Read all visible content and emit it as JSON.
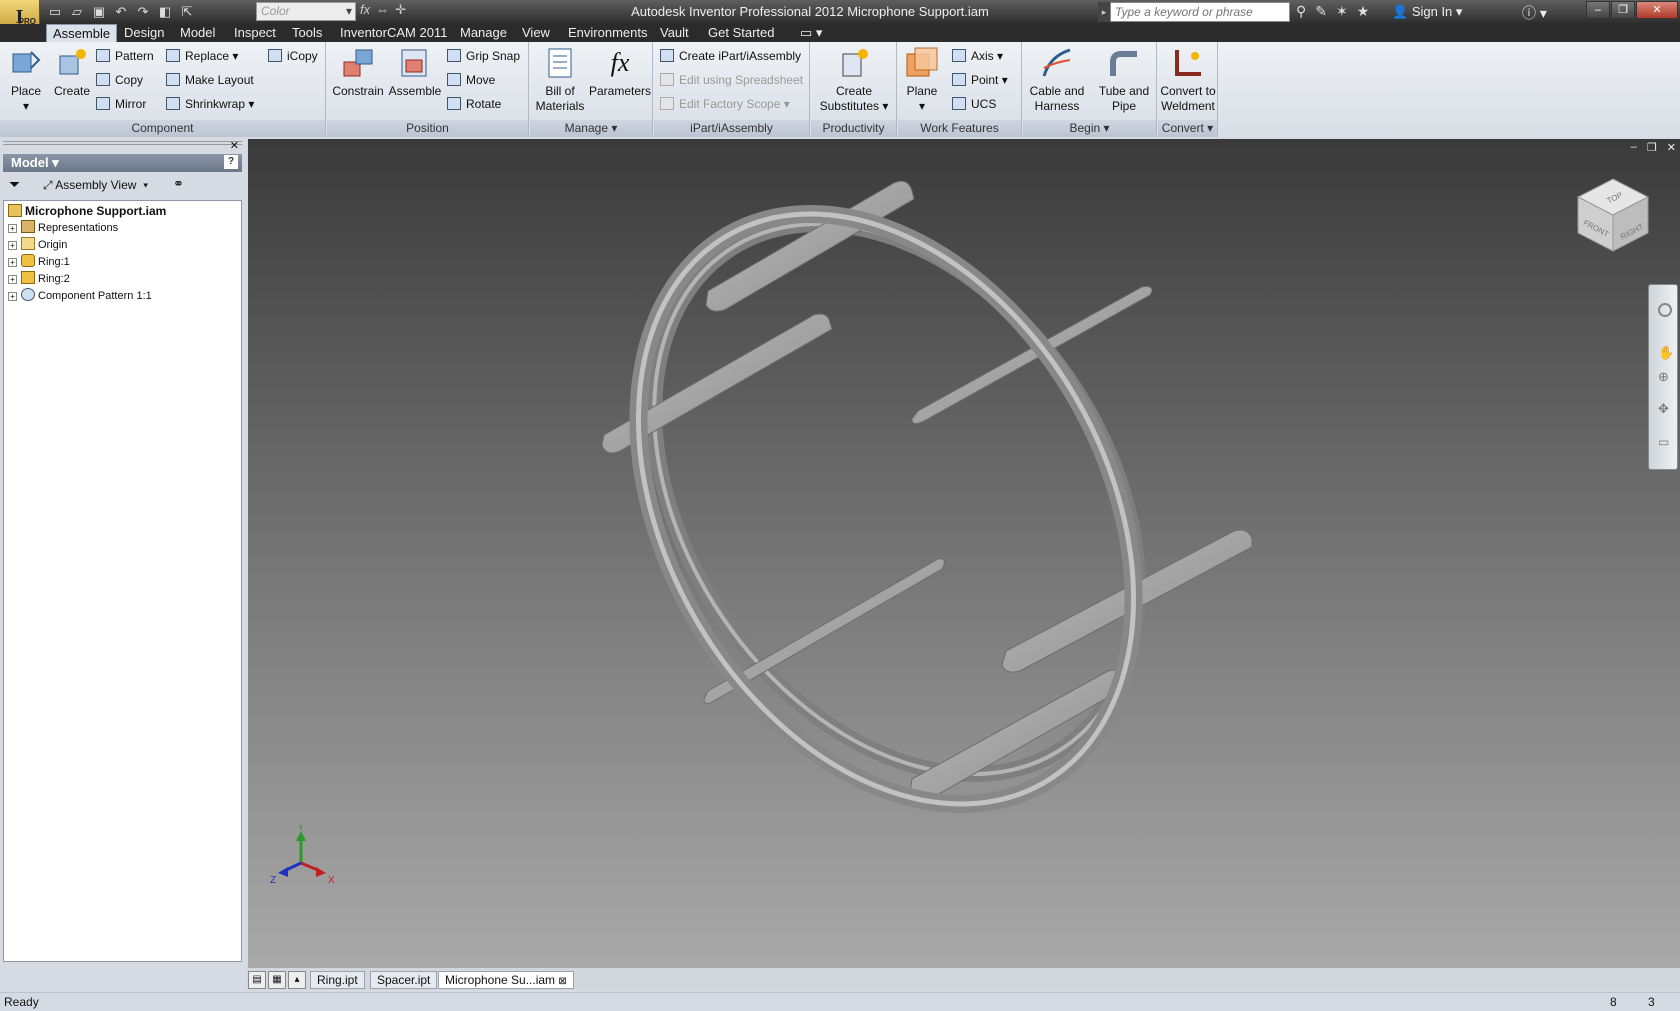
{
  "app": {
    "title": "Autodesk Inventor Professional 2012   Microphone Support.iam",
    "logo_badge": "PRO"
  },
  "quick_access": {
    "color_placeholder": "Color"
  },
  "search": {
    "placeholder": "Type a keyword or phrase"
  },
  "sign_in_label": "Sign In",
  "tabs": [
    {
      "label": "Assemble",
      "active": true
    },
    {
      "label": "Design"
    },
    {
      "label": "Model"
    },
    {
      "label": "Inspect"
    },
    {
      "label": "Tools"
    },
    {
      "label": "InventorCAM 2011"
    },
    {
      "label": "Manage"
    },
    {
      "label": "View"
    },
    {
      "label": "Environments"
    },
    {
      "label": "Vault"
    },
    {
      "label": "Get Started"
    }
  ],
  "ribbon": {
    "component": {
      "title": "Component",
      "place": "Place",
      "create": "Create",
      "pattern": "Pattern",
      "copy": "Copy",
      "mirror": "Mirror",
      "replace": "Replace",
      "make_layout": "Make Layout",
      "shrinkwrap": "Shrinkwrap",
      "icopy": "iCopy"
    },
    "position": {
      "title": "Position",
      "constrain": "Constrain",
      "assemble": "Assemble",
      "grip_snap": "Grip Snap",
      "move": "Move",
      "rotate": "Rotate"
    },
    "manage": {
      "title": "Manage",
      "bom_line1": "Bill of",
      "bom_line2": "Materials",
      "parameters": "Parameters"
    },
    "ipart": {
      "title": "iPart/iAssembly",
      "create": "Create iPart/iAssembly",
      "edit_spreadsheet": "Edit using Spreadsheet",
      "edit_factory": "Edit Factory Scope"
    },
    "productivity": {
      "title": "Productivity",
      "line1": "Create",
      "line2": "Substitutes"
    },
    "work_features": {
      "title": "Work Features",
      "plane": "Plane",
      "axis": "Axis",
      "point": "Point",
      "ucs": "UCS"
    },
    "begin": {
      "title": "Begin",
      "cable_line1": "Cable and",
      "cable_line2": "Harness",
      "tube_line1": "Tube and",
      "tube_line2": "Pipe"
    },
    "convert": {
      "title": "Convert",
      "line1": "Convert to",
      "line2": "Weldment"
    }
  },
  "browser": {
    "header": "Model",
    "view_select": "Assembly View",
    "tree": [
      {
        "label": "Microphone Support.iam",
        "root": true
      },
      {
        "label": "Representations"
      },
      {
        "label": "Origin"
      },
      {
        "label": "Ring:1"
      },
      {
        "label": "Ring:2"
      },
      {
        "label": "Component Pattern 1:1"
      }
    ]
  },
  "viewcube": {
    "top": "TOP",
    "front": "FRONT",
    "right": "RIGHT"
  },
  "triad": {
    "x": "X",
    "y": "Y",
    "z": "Z"
  },
  "doc_tabs": [
    {
      "label": "Ring.ipt"
    },
    {
      "label": "Spacer.ipt"
    },
    {
      "label": "Microphone Su...iam",
      "active": true
    }
  ],
  "status": {
    "text": "Ready",
    "count1": "8",
    "count2": "3"
  },
  "colors": {
    "titlebar": "#3a3a3a",
    "ribbon": "#e4e8ee",
    "viewport_top": "#3a3a3a",
    "viewport_bottom": "#a9a9a9",
    "part": "#9a9a9a"
  }
}
